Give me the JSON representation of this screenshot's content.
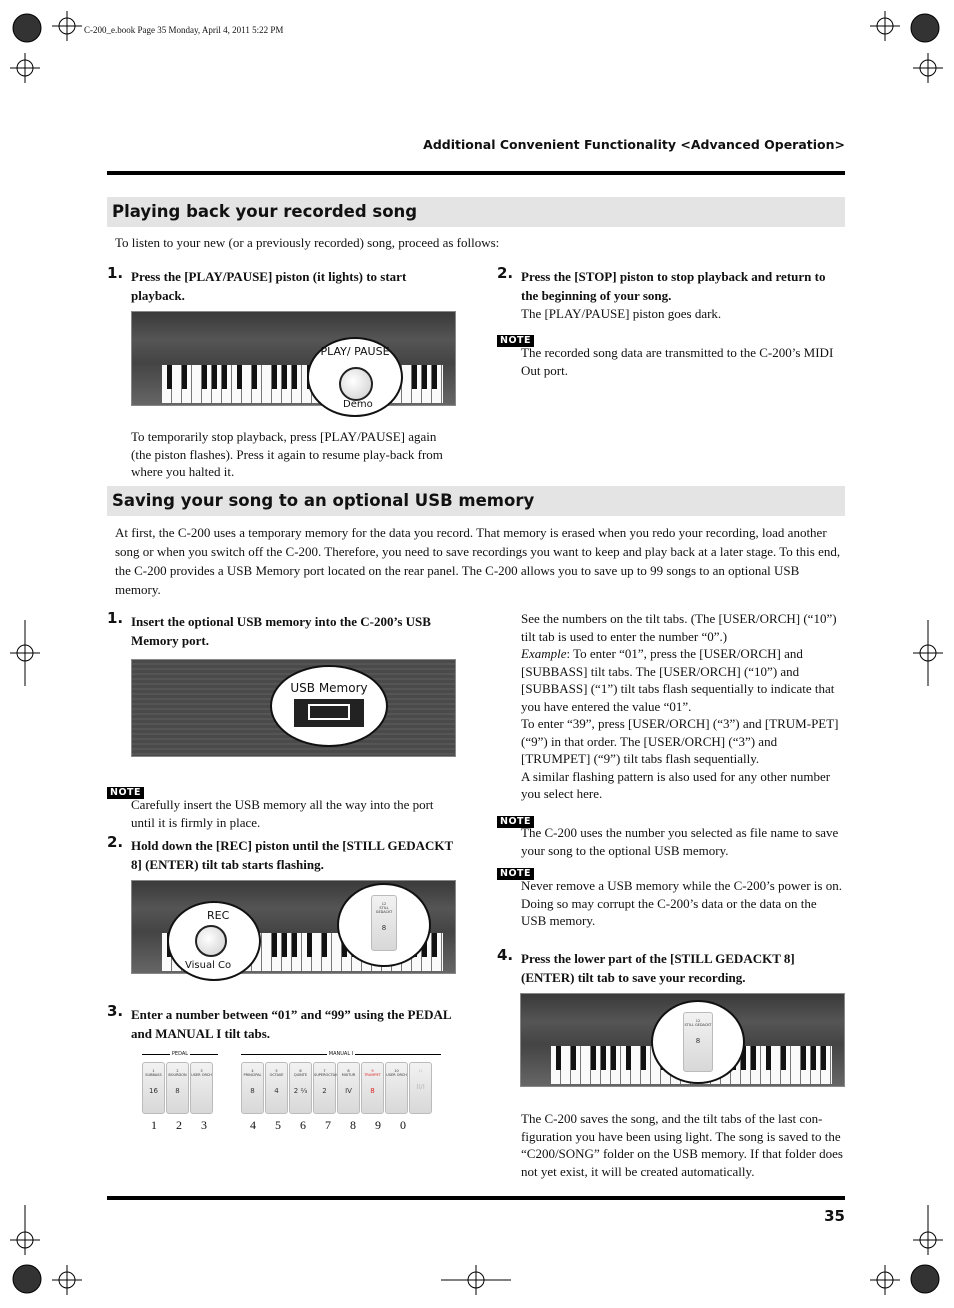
{
  "print_info": "C-200_e.book  Page 35  Monday, April 4, 2011  5:22 PM",
  "running_header": "Additional Convenient Functionality <Advanced Operation>",
  "note_label": "NOTE",
  "section1": {
    "title": "Playing back your recorded song",
    "intro": "To listen to your new (or a previously recorded) song, proceed as follows:",
    "step1": {
      "num": "1.",
      "text": "Press the [PLAY/PAUSE] piston (it lights) to start playback.",
      "callout": "PLAY/ PAUSE",
      "callout_sub": "Demo",
      "after": "To temporarily stop playback, press [PLAY/PAUSE] again (the piston flashes). Press it again to resume play-back from where you halted it."
    },
    "step2": {
      "num": "2.",
      "text": "Press the [STOP] piston to stop playback and return to the beginning of your song.",
      "after": "The [PLAY/PAUSE] piston goes dark.",
      "note": "The recorded song data are transmitted to the C-200’s MIDI Out port."
    }
  },
  "section2": {
    "title": "Saving your song to an optional USB memory",
    "intro": "At first, the C-200 uses a temporary memory for the data you record. That memory is erased when you redo your recording, load another song or when you switch off the C-200. Therefore, you need to save recordings you want to keep and play back at a later stage. To this end, the C-200 provides a USB Memory port located on the rear panel. The C-200 allows you to save up to 99 songs to an optional USB memory.",
    "step1": {
      "num": "1.",
      "text": "Insert the optional USB memory into the C-200’s USB Memory port.",
      "callout": "USB Memory",
      "note": "Carefully insert the USB memory all the way into the port until it is firmly in place."
    },
    "step2": {
      "num": "2.",
      "text": "Hold down the [REC] piston until the [STILL GEDACKT 8] (ENTER) tilt tab starts flashing.",
      "callout_rec": "REC",
      "callout_rec_sub": "Visual Co",
      "callout_tab": [
        "12",
        "STILL GEDACKT",
        "8"
      ]
    },
    "step3": {
      "num": "3.",
      "text": "Enter a number between “01” and “99” using the PEDAL and MANUAL I tilt tabs.",
      "groups": {
        "pedal": "PEDAL",
        "manual": "MANUAL I"
      },
      "pedal_tabs": [
        {
          "n": "1",
          "name": "SUBBASS",
          "val": "16",
          "digit": "1"
        },
        {
          "n": "2",
          "name": "BOURDON",
          "val": "8",
          "digit": "2"
        },
        {
          "n": "3",
          "name": "USER ORCH",
          "val": "",
          "digit": "3"
        }
      ],
      "manual_tabs": [
        {
          "n": "4",
          "name": "PRINCIPAL",
          "val": "8",
          "digit": "4"
        },
        {
          "n": "5",
          "name": "OCTAVE",
          "val": "4",
          "digit": "5"
        },
        {
          "n": "6",
          "name": "QUINTE",
          "val": "2 ⅔",
          "digit": "6"
        },
        {
          "n": "7",
          "name": "SUPEROCTAV",
          "val": "2",
          "digit": "7"
        },
        {
          "n": "8",
          "name": "MIXTUR",
          "val": "IV",
          "digit": "8"
        },
        {
          "n": "9",
          "name": "TRUMPET",
          "val": "8",
          "digit": "9",
          "red": true
        },
        {
          "n": "10",
          "name": "USER ORCH",
          "val": "",
          "digit": "0"
        },
        {
          "n": "11",
          "name": "",
          "val": "II/I",
          "digit": "",
          "faded": true
        }
      ]
    },
    "right_col": {
      "p1": "See the numbers on the tilt tabs. (The [USER/ORCH] (“10”) tilt tab is used to enter the number “0”.)",
      "example_label": "Example",
      "p2": ": To enter “01”, press the [USER/ORCH] and [SUBBASS] tilt tabs. The [USER/ORCH] (“10”) and [SUBBASS] (“1”) tilt tabs flash sequentially to indicate that you have entered the value “01”.",
      "p3": "To enter “39”, press [USER/ORCH] (“3”) and [TRUM-PET] (“9”) in that order. The [USER/ORCH] (“3”) and [TRUMPET] (“9”) tilt tabs flash sequentially.",
      "p4": "A similar flashing pattern is also used for any other number you select here.",
      "note1": "The C-200 uses the number you selected as file name to save your song to the optional USB memory.",
      "note2": "Never remove a USB memory while the C-200’s power is on. Doing so may corrupt the C-200’s data or the data on the USB memory."
    },
    "step4": {
      "num": "4.",
      "text": "Press the lower part of the [STILL GEDACKT 8] (ENTER) tilt tab to save your recording.",
      "callout_tab": [
        "12",
        "STILL GEDACKT",
        "8"
      ],
      "after": "The C-200 saves the song, and the tilt tabs of the last con-figuration you have been using light. The song is saved to the “C200/SONG” folder on the USB memory. If that folder does not yet exist, it will be created automatically."
    }
  },
  "page_number": "35",
  "colors": {
    "section_bg": "#e4e4e4",
    "trumpet_red": "#e02020"
  }
}
